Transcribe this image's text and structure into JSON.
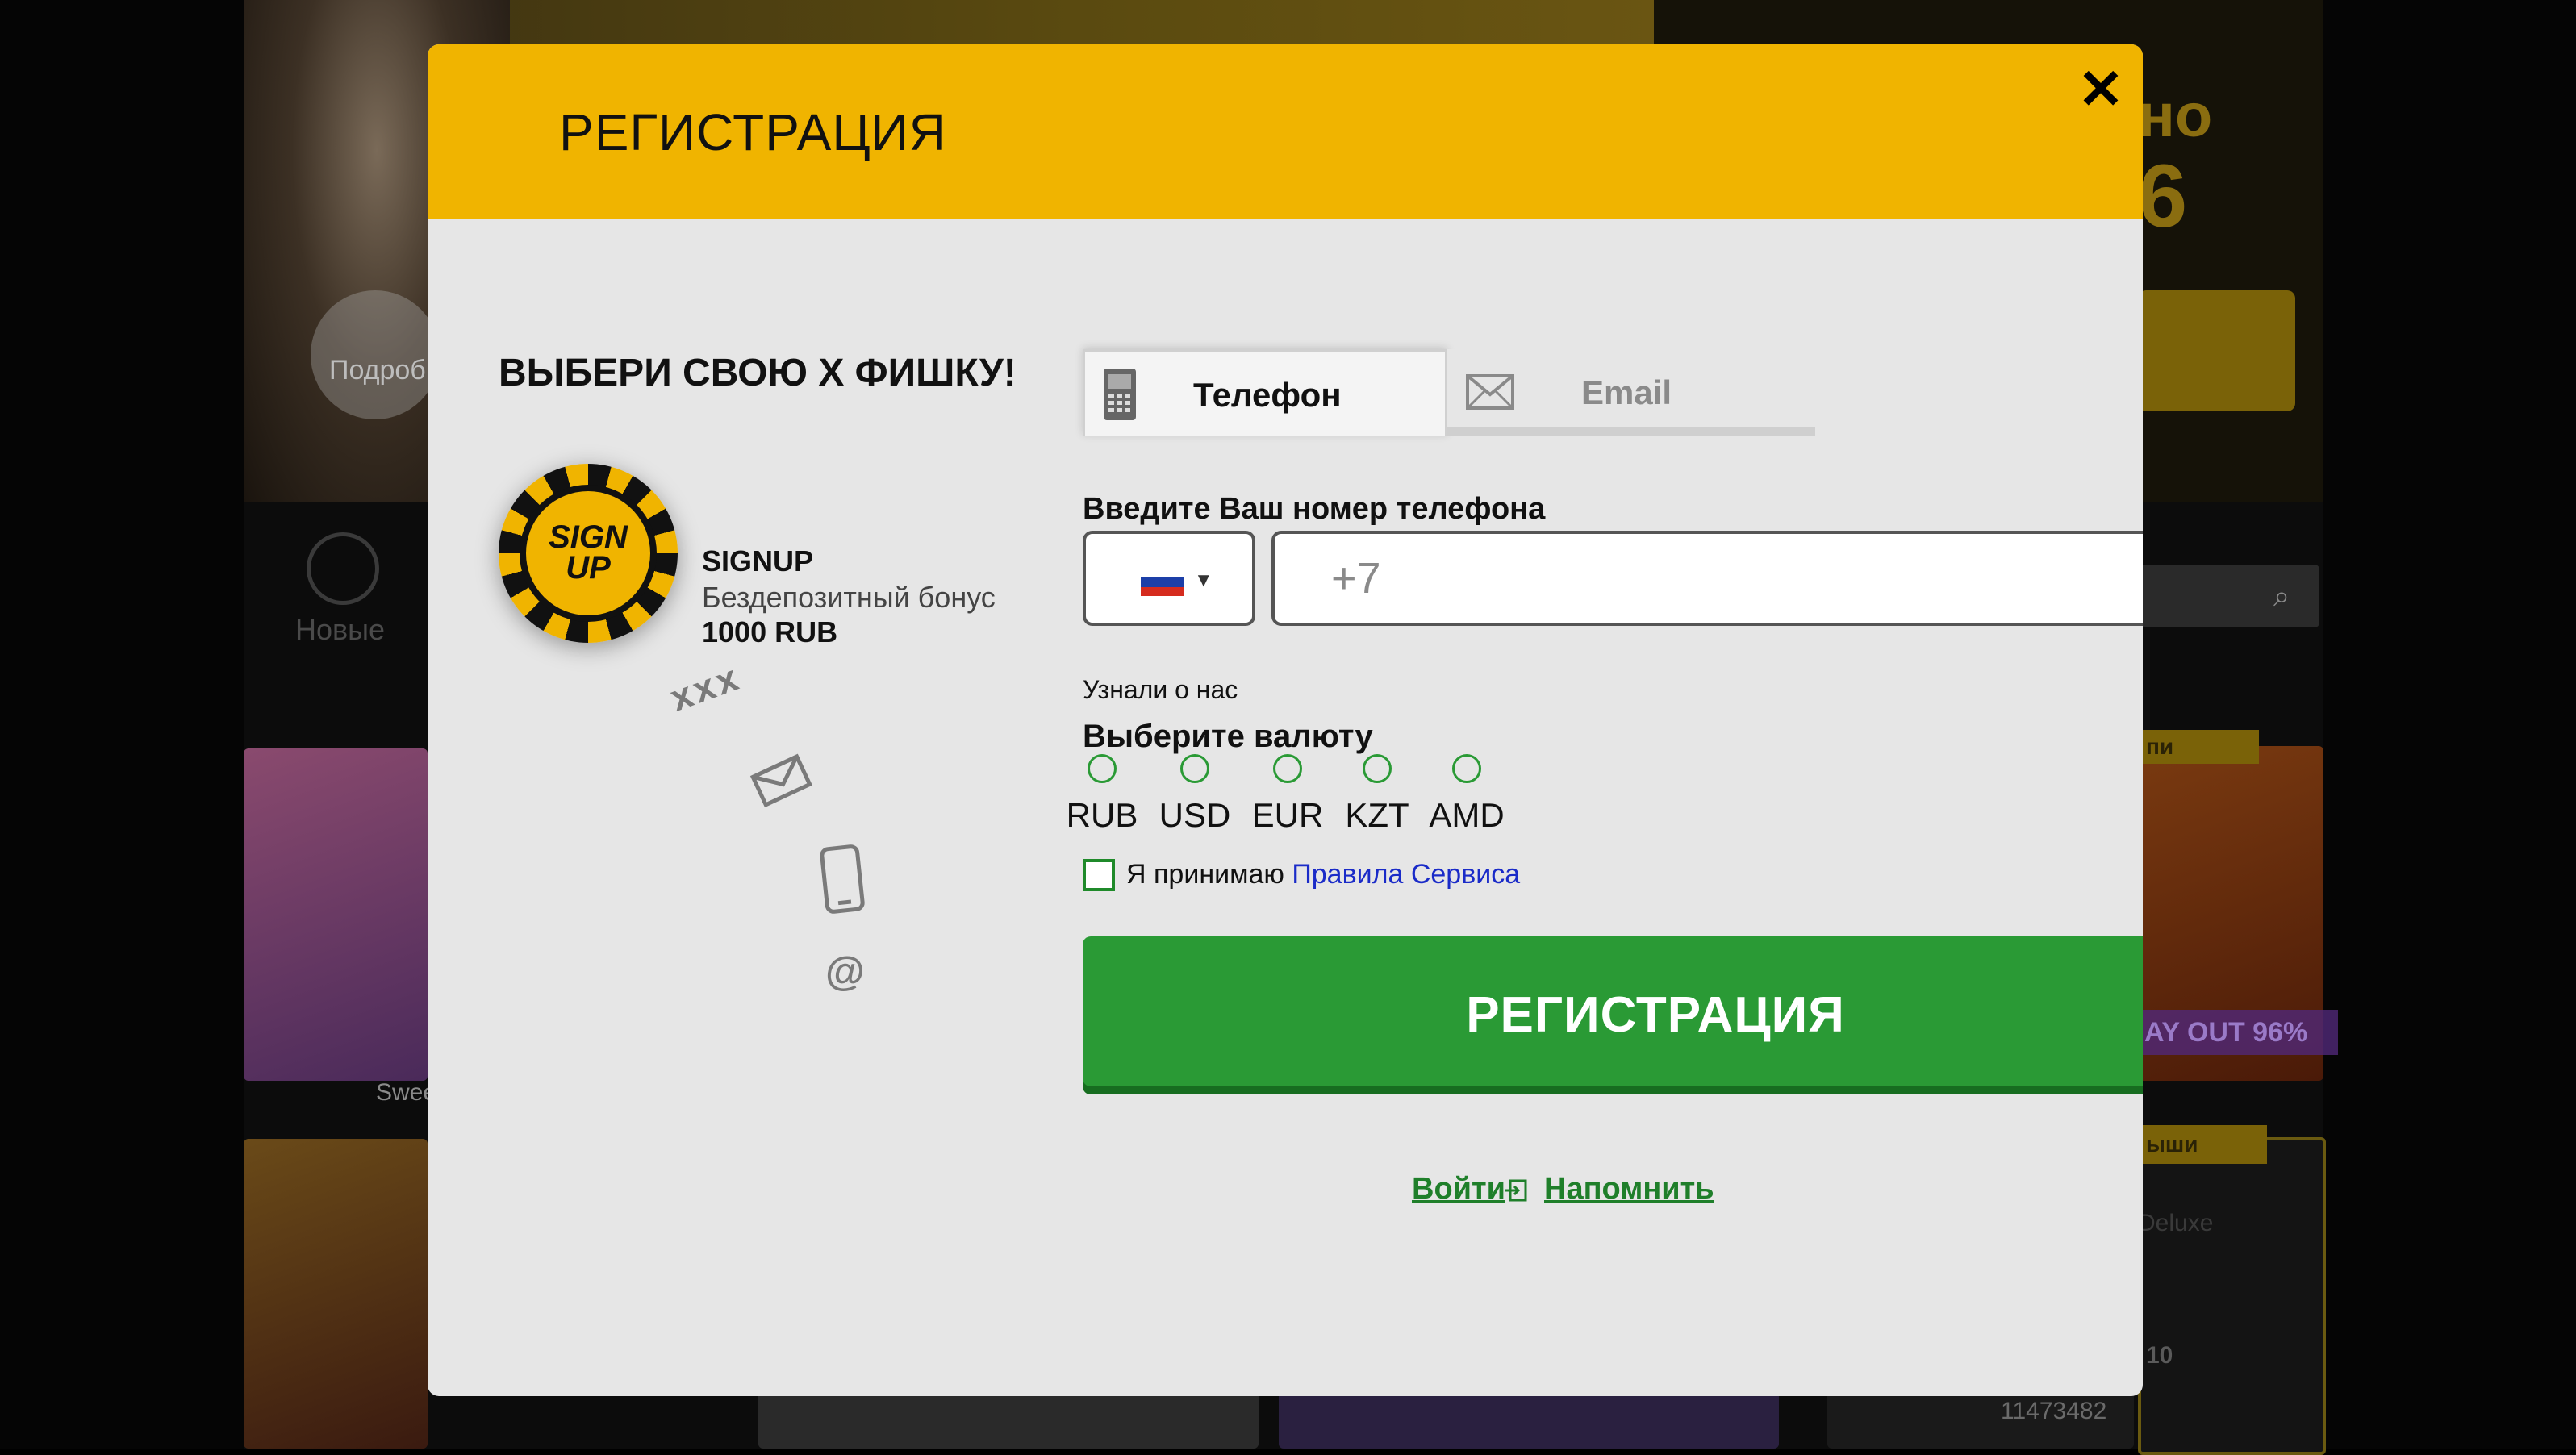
{
  "background": {
    "more_label": "Подроб",
    "big_text_1": "но",
    "big_text_2": "6",
    "new_label": "Новые",
    "sweet_label": "Swee",
    "payout_badge": "AY OUT 96%",
    "tag_1": "пи",
    "tag_2": "ыши",
    "deluxe_label": "Deluxe",
    "slot_number": "10",
    "jackpot_value": "11473482"
  },
  "modal": {
    "title": "РЕГИСТРАЦИЯ",
    "close_symbol": "✕"
  },
  "promo": {
    "title": "ВЫБЕРИ СВОЮ Х ФИШКУ!",
    "chip_text": "SIGN UP",
    "bonus_code": "SIGNUP",
    "bonus_desc": "Бездепозитный бонус",
    "bonus_amount": "1000 RUB",
    "deco_x": "xxx",
    "deco_at": "@"
  },
  "tabs": [
    {
      "label": "Телефон",
      "icon": "mobile-phone-icon",
      "active": true
    },
    {
      "label": "Email",
      "icon": "envelope-icon",
      "active": false
    }
  ],
  "form": {
    "phone_label": "Введите Ваш номер телефона",
    "country_flag": "russia-flag",
    "phone_placeholder": "+7",
    "source_link": "Узнали о нас",
    "currency_label": "Выберите валюту",
    "currencies": [
      "RUB",
      "USD",
      "EUR",
      "KZT",
      "AMD"
    ],
    "terms_prefix": "Я принимаю ",
    "terms_link": "Правила Сервиса",
    "register_button": "РЕГИСТРАЦИЯ",
    "login_link": "Войти",
    "remind_link": "Напомнить"
  },
  "colors": {
    "header": "#f0b400",
    "primary_button": "#2a9a35",
    "link": "#1a2bc8"
  }
}
